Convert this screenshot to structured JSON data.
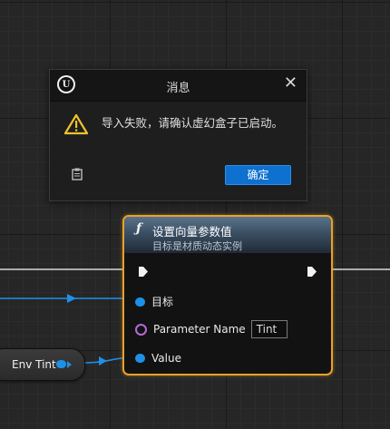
{
  "dialog": {
    "title": "消息",
    "close_glyph": "✕",
    "message": "导入失败，请确认虚幻盒子已启动。",
    "ok_label": "确定",
    "icons": [
      "unreal-logo-icon",
      "warning-icon",
      "clipboard-icon",
      "close-icon"
    ],
    "logo_letter": "U"
  },
  "env_node": {
    "label": "Env Tint"
  },
  "function_node": {
    "icon_glyph": "ƒ",
    "title": "设置向量参数值",
    "subtitle": "目标是材质动态实例",
    "pins": {
      "target_label": "目标",
      "parameter_name_label": "Parameter Name",
      "parameter_name_value": "Tint",
      "value_label": "Value"
    }
  },
  "colors": {
    "accent_blue": "#0e70cf",
    "pin_blue": "#1e90e8",
    "node_selected_border": "#e7a12b",
    "name_pin_purple": "#b36ad6",
    "warning_yellow": "#f0c22c"
  }
}
